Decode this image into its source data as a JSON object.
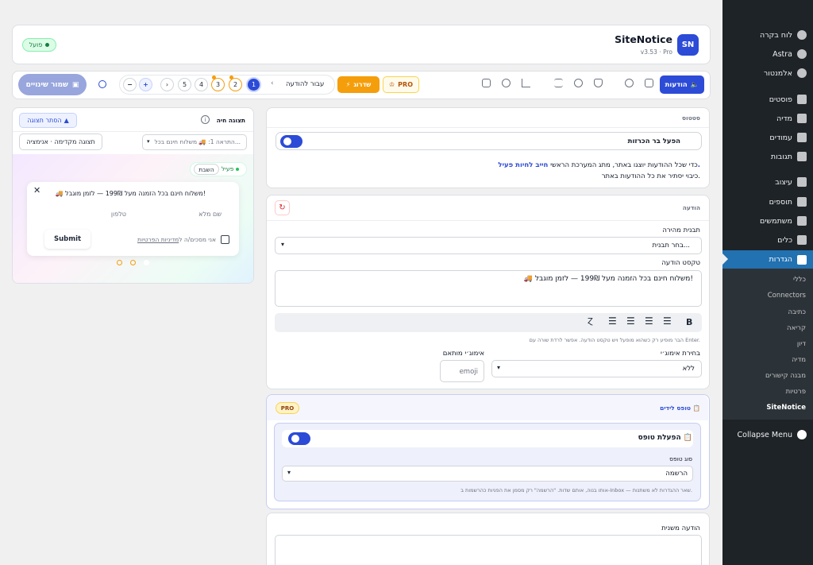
{
  "sidebar": {
    "items": [
      {
        "label": "לוח בקרה",
        "icon": "dashboard-icon"
      },
      {
        "label": "Astra",
        "icon": "astra-icon"
      },
      {
        "label": "אלמנטור",
        "icon": "elementor-icon"
      },
      {
        "label": "פוסטים",
        "icon": "pin-icon"
      },
      {
        "label": "מדיה",
        "icon": "media-icon"
      },
      {
        "label": "עמודים",
        "icon": "pages-icon"
      },
      {
        "label": "תגובות",
        "icon": "comments-icon"
      },
      {
        "label": "עיצוב",
        "icon": "appearance-icon"
      },
      {
        "label": "תוספים",
        "icon": "plugins-icon"
      },
      {
        "label": "משתמשים",
        "icon": "users-icon"
      },
      {
        "label": "כלים",
        "icon": "tools-icon"
      },
      {
        "label": "הגדרות",
        "icon": "settings-icon"
      }
    ],
    "submenu": [
      "כללי",
      "Connectors",
      "כתיבה",
      "קריאה",
      "דיון",
      "מדיה",
      "מבנה קישורים",
      "פרטיות",
      "SiteNotice"
    ],
    "collapse": "Collapse Menu"
  },
  "header": {
    "title": "SiteNotice",
    "version": "v3.53 · Pro",
    "logo": "SN",
    "status": "פועל"
  },
  "toolbar": {
    "notices_tab": "הודעות",
    "pro": "PRO",
    "upgrade": "שדרוג",
    "goto": "עבור להודעה",
    "pages": [
      "1",
      "2",
      "3",
      "4",
      "5"
    ],
    "save": "שמור שינויים"
  },
  "status_card": {
    "title": "סטטוס",
    "toggle_label": "הפעל בר הכרזות",
    "desc_prefix": "כדי שכל ההודעות יוצגו באתר, מתג המערכת הראשי ",
    "desc_link": "חייב לחיות פעיל.",
    "desc2": "כיבוי יסתיר את כל ההודעות באתר."
  },
  "notice_card": {
    "title": "הודעה",
    "template_label": "תבנית מהירה",
    "template_value": "בחר תבנית...",
    "text_label": "טקסט הודעה",
    "text_value": "🚚 משלוח חינם בכל הזמנה מעל 199₪ — לזמן מוגבל!",
    "hint": "הבר מופיע רק כשהוא מופעל ויש טקסט הודעה. אפשר לרדת שורה עם Enter.",
    "emoji_label": "בחירת אימוג׳י",
    "emoji_value": "ללא",
    "custom_emoji_label": "אימוג׳י מותאם",
    "custom_emoji_placeholder": "emoji"
  },
  "leads_card": {
    "title": "טופס לידים",
    "pro": "PRO",
    "enable_label": "הפעלת טופס",
    "type_label": "סוג טופס",
    "type_value": "הרשמה",
    "hint": "אותו בנוה, אותם שדות. \"הרשמה\" רק מסמן את הפניות כהרשמות ב-Inbox — שאר ההגדרות לא משתנות."
  },
  "secondary": {
    "label": "הודעה משנית"
  },
  "preview": {
    "title": "תצוגה חיה",
    "hide_btn": "הסתר תצוגה",
    "select_value": "התראה 1: 🚚 משלוח חינם בכל...",
    "anim_btn": "תצוגה מקדימה · אנימציה",
    "active": "פעיל",
    "paused": "השבת",
    "bar_text": "🚚 משלוח חינם בכל הזמנה מעל 199₪ — לזמן מוגבל!",
    "name_ph": "שם מלא",
    "phone_ph": "טלפון",
    "consent_prefix": "אני מסכים/ה ל",
    "consent_link": "מדיניות הפרטיות",
    "submit": "Submit"
  },
  "colors": {
    "accent": "#2c4bd6",
    "wp_active": "#2271b1",
    "sidebar": "#1d2327",
    "upgrade": "#f59e0b",
    "status_green": "#22c55e"
  }
}
